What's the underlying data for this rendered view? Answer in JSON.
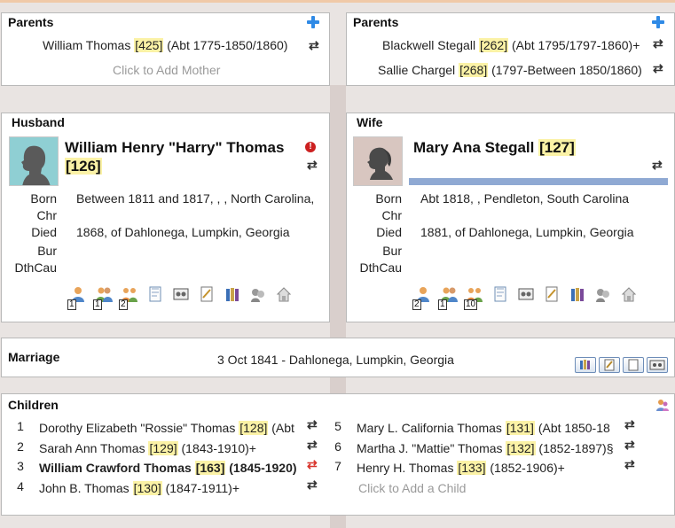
{
  "colors": {
    "highlight": "#fbf2a6",
    "link_gray": "#9a9a9a",
    "accent_blue": "#2f8ae6",
    "alert_red": "#cc2020",
    "wife_bar": "#8fa9d3"
  },
  "husband_parents": {
    "title": "Parents",
    "father": {
      "name": "William Thomas",
      "id": "425",
      "dates": "(Abt 1775-1850/1860)"
    },
    "add_mother": "Click to Add Mother"
  },
  "wife_parents": {
    "title": "Parents",
    "father": {
      "name": "Blackwell Stegall",
      "id": "262",
      "dates": "(Abt 1795/1797-1860)+"
    },
    "mother": {
      "name": "Sallie Chargel",
      "id": "268",
      "dates": "(1797-Between 1850/1860)"
    }
  },
  "husband": {
    "title": "Husband",
    "name": "William Henry \"Harry\" Thomas",
    "id": "126",
    "alert": "!",
    "facts": [
      {
        "label": "Born",
        "value": "Between 1811 and 1817, , , North Carolina,"
      },
      {
        "label": "Chr",
        "value": ""
      },
      {
        "label": "Died",
        "value": "1868, of Dahlonega, Lumpkin, Georgia"
      },
      {
        "label": "Bur",
        "value": ""
      },
      {
        "label": "DthCau",
        "value": ""
      }
    ],
    "icons": [
      {
        "name": "parents-icon",
        "count": "1"
      },
      {
        "name": "spouses-icon",
        "count": "1"
      },
      {
        "name": "children-icon",
        "count": "2"
      },
      {
        "name": "notes-icon",
        "count": ""
      },
      {
        "name": "media-icon",
        "count": ""
      },
      {
        "name": "events-icon",
        "count": ""
      },
      {
        "name": "sources-icon",
        "count": ""
      },
      {
        "name": "associations-icon",
        "count": ""
      },
      {
        "name": "address-icon",
        "count": ""
      }
    ]
  },
  "wife": {
    "title": "Wife",
    "name": "Mary Ana Stegall",
    "id": "127",
    "facts": [
      {
        "label": "Born",
        "value": "Abt 1818, , Pendleton, South Carolina"
      },
      {
        "label": "Chr",
        "value": ""
      },
      {
        "label": "Died",
        "value": "1881, of Dahlonega, Lumpkin, Georgia"
      },
      {
        "label": "Bur",
        "value": ""
      },
      {
        "label": "DthCau",
        "value": ""
      }
    ],
    "icons": [
      {
        "name": "parents-icon",
        "count": "2"
      },
      {
        "name": "spouses-icon",
        "count": "1"
      },
      {
        "name": "children-icon",
        "count": "10"
      },
      {
        "name": "notes-icon",
        "count": ""
      },
      {
        "name": "media-icon",
        "count": ""
      },
      {
        "name": "events-icon",
        "count": ""
      },
      {
        "name": "sources-icon",
        "count": ""
      },
      {
        "name": "associations-icon",
        "count": ""
      },
      {
        "name": "address-icon",
        "count": ""
      }
    ]
  },
  "marriage": {
    "title": "Marriage",
    "value": "3 Oct 1841 - Dahlonega, Lumpkin, Georgia",
    "buttons": [
      "sources-button-icon",
      "notes-button-icon",
      "blank-button-icon",
      "media-button-icon"
    ]
  },
  "children": {
    "title": "Children",
    "add_child": "Click to Add a Child",
    "left": [
      {
        "num": "1",
        "name": "Dorothy Elizabeth \"Rossie\" Thomas",
        "id": "128",
        "dates": "(Abt",
        "bold": false,
        "swap_red": false
      },
      {
        "num": "2",
        "name": "Sarah Ann Thomas",
        "id": "129",
        "dates": "(1843-1910)+",
        "bold": false,
        "swap_red": false
      },
      {
        "num": "3",
        "name": "William Crawford Thomas",
        "id": "163",
        "dates": "(1845-1920)",
        "bold": true,
        "swap_red": true
      },
      {
        "num": "4",
        "name": "John B. Thomas",
        "id": "130",
        "dates": "(1847-1911)+",
        "bold": false,
        "swap_red": false
      }
    ],
    "right": [
      {
        "num": "5",
        "name": "Mary L. California Thomas",
        "id": "131",
        "dates": "(Abt 1850-18",
        "bold": false,
        "swap_red": false
      },
      {
        "num": "6",
        "name": "Martha J. \"Mattie\" Thomas",
        "id": "132",
        "dates": "(1852-1897)§",
        "bold": false,
        "swap_red": false
      },
      {
        "num": "7",
        "name": "Henry H. Thomas",
        "id": "133",
        "dates": "(1852-1906)+",
        "bold": false,
        "swap_red": false
      }
    ]
  },
  "glyphs": {
    "swap": "⇄"
  }
}
